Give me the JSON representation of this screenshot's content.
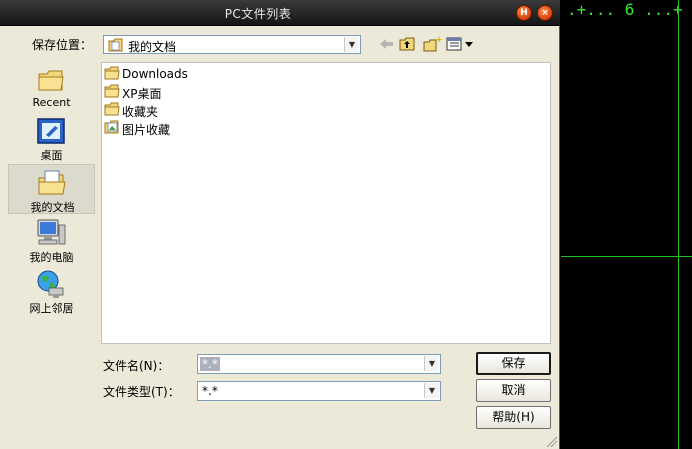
{
  "window": {
    "title": "PC文件列表",
    "help_btn": "H",
    "close_btn": "×"
  },
  "lookin": {
    "label": "保存位置：",
    "value": "我的文档"
  },
  "places": [
    {
      "label": "Recent"
    },
    {
      "label": "桌面"
    },
    {
      "label": "我的文档",
      "selected": true
    },
    {
      "label": "我的电脑"
    },
    {
      "label": "网上邻居"
    }
  ],
  "files": [
    {
      "name": "Downloads",
      "icon": "folder-icon"
    },
    {
      "name": "XP桌面",
      "icon": "folder-icon"
    },
    {
      "name": "收藏夹",
      "icon": "folder-icon"
    },
    {
      "name": "图片收藏",
      "icon": "picture-folder-icon"
    }
  ],
  "filename": {
    "label": "文件名(N)：",
    "value": "*.*"
  },
  "filetype": {
    "label": "文件类型(T)：",
    "value": "*.*"
  },
  "buttons": {
    "save": "保存",
    "cancel": "取消",
    "help": "帮助(H)"
  },
  "terminal": {
    "text": ".+... 6 ...+"
  },
  "colors": {
    "dialog_bg": "#ece9d8",
    "titlebar": "#1e1e1e",
    "terminal_green": "#2ee82e"
  }
}
